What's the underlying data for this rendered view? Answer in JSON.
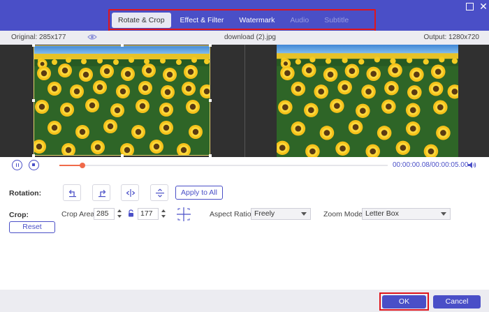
{
  "window": {
    "tabs": [
      {
        "label": "Rotate & Crop",
        "state": "active"
      },
      {
        "label": "Effect & Filter",
        "state": "normal"
      },
      {
        "label": "Watermark",
        "state": "normal"
      },
      {
        "label": "Audio",
        "state": "disabled"
      },
      {
        "label": "Subtitle",
        "state": "disabled"
      }
    ],
    "close_glyph": "✕"
  },
  "info": {
    "original": "Original: 285x177",
    "filename": "download (2).jpg",
    "output": "Output: 1280x720"
  },
  "playback": {
    "progress": 0.07,
    "current_time": "00:00:00.08",
    "total_time": "/00:00:05.00"
  },
  "rotation": {
    "label": "Rotation:",
    "apply_all": "Apply to All"
  },
  "crop": {
    "label": "Crop:",
    "area_label": "Crop Area:",
    "width": "285",
    "height": "177",
    "reset": "Reset",
    "aspect_label": "Aspect Ratio:",
    "aspect_value": "Freely",
    "zoom_label": "Zoom Mode:",
    "zoom_value": "Letter Box"
  },
  "footer": {
    "ok": "OK",
    "cancel": "Cancel"
  },
  "colors": {
    "accent": "#4a4fc7",
    "highlight_box": "#e0151c",
    "progress": "#f06a4a"
  }
}
